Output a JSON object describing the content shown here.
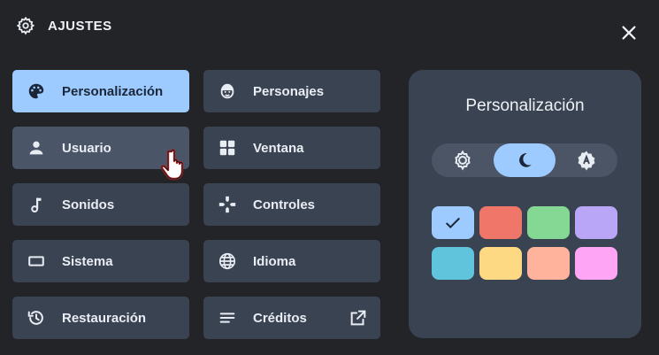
{
  "header": {
    "title": "AJUSTES",
    "icon": "gear-icon"
  },
  "close_icon": "close-icon",
  "menu": [
    {
      "label": "Personalización",
      "icon": "palette-icon",
      "active": true
    },
    {
      "label": "Personajes",
      "icon": "character-icon"
    },
    {
      "label": "Usuario",
      "icon": "user-icon",
      "hover": true
    },
    {
      "label": "Ventana",
      "icon": "grid-icon"
    },
    {
      "label": "Sonidos",
      "icon": "music-note-icon"
    },
    {
      "label": "Controles",
      "icon": "gamepad-icon"
    },
    {
      "label": "Sistema",
      "icon": "rectangle-icon"
    },
    {
      "label": "Idioma",
      "icon": "globe-icon"
    },
    {
      "label": "Restauración",
      "icon": "restore-icon"
    },
    {
      "label": "Créditos",
      "icon": "list-icon",
      "extra_icon": "external-link-icon"
    }
  ],
  "panel": {
    "title": "Personalización",
    "theme_options": [
      {
        "icon": "sun-icon"
      },
      {
        "icon": "moon-icon",
        "selected": true
      },
      {
        "icon": "auto-brightness-icon"
      }
    ],
    "colors": [
      "#9ecbff",
      "#f0766a",
      "#85d893",
      "#b9a6f7",
      "#5fc4dc",
      "#fed983",
      "#ffb39c",
      "#ffa5f5"
    ],
    "selected_color_index": 0
  },
  "colors": {
    "background": "#222428",
    "button": "#3a4352",
    "accent": "#9ecbff"
  }
}
